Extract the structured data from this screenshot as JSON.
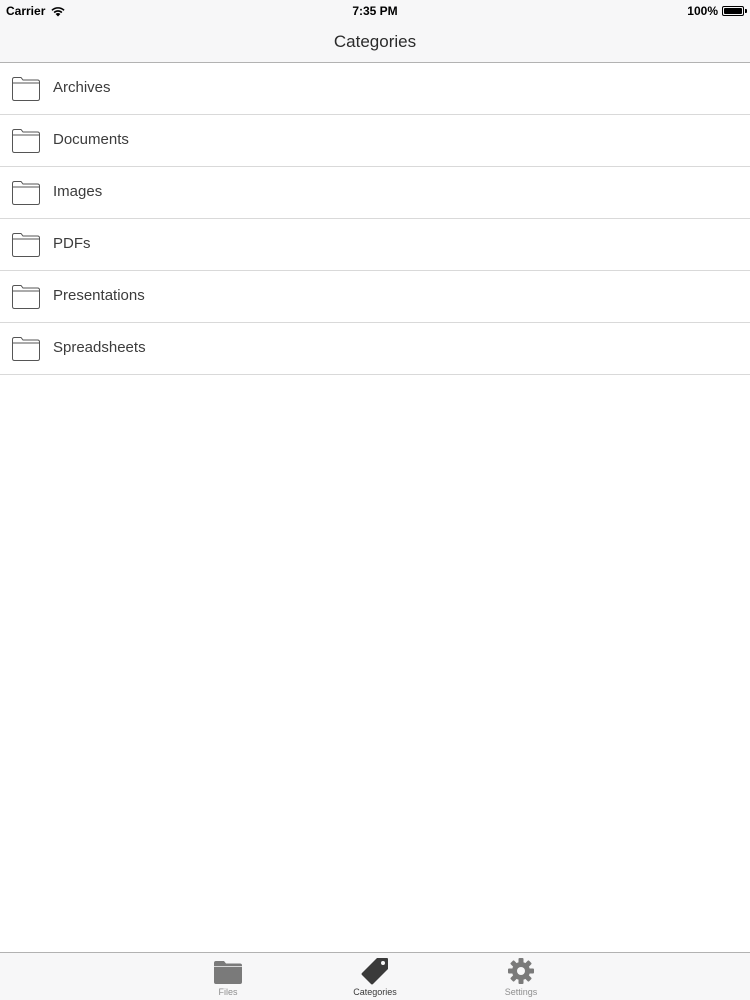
{
  "status_bar": {
    "carrier": "Carrier",
    "time": "7:35 PM",
    "battery": "100%",
    "battery_level": 1.0,
    "wifi_icon": "wifi-icon",
    "battery_icon": "battery-icon"
  },
  "nav": {
    "title": "Categories"
  },
  "categories": [
    {
      "label": "Archives",
      "icon": "folder-icon"
    },
    {
      "label": "Documents",
      "icon": "folder-icon"
    },
    {
      "label": "Images",
      "icon": "folder-icon"
    },
    {
      "label": "PDFs",
      "icon": "folder-icon"
    },
    {
      "label": "Presentations",
      "icon": "folder-icon"
    },
    {
      "label": "Spreadsheets",
      "icon": "folder-icon"
    }
  ],
  "tab_bar": {
    "tabs": [
      {
        "label": "Files",
        "icon": "folder-filled-icon",
        "active": false
      },
      {
        "label": "Categories",
        "icon": "tag-icon",
        "active": true
      },
      {
        "label": "Settings",
        "icon": "gear-icon",
        "active": false
      }
    ]
  },
  "colors": {
    "bar_background": "#f7f7f8",
    "separator": "#d9d9d9",
    "icon_inactive": "#7a7a7a",
    "icon_active": "#3a3a3a",
    "label_inactive": "#8e8e8e"
  }
}
